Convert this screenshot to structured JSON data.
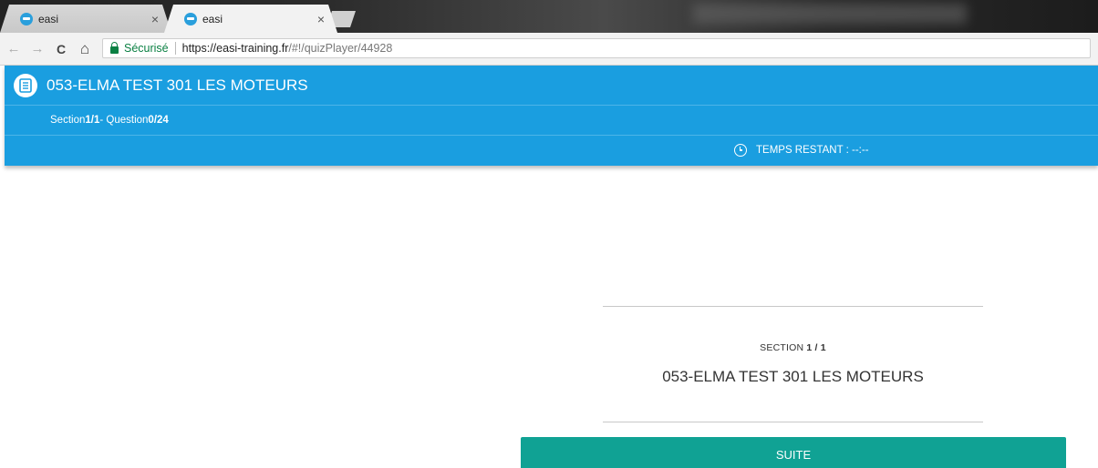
{
  "browser": {
    "tabs": [
      {
        "title": "easi",
        "active": false
      },
      {
        "title": "easi",
        "active": true
      }
    ],
    "close_glyph": "×",
    "nav": {
      "back": "←",
      "forward": "→",
      "reload": "C",
      "home": "⌂"
    },
    "secure_label": "Sécurisé",
    "url_host": "https://easi-training.fr",
    "url_path": "/#!/quizPlayer/44928"
  },
  "header": {
    "title": "053-ELMA TEST 301 LES MOTEURS",
    "progress": {
      "section_prefix": "Section ",
      "section_value": "1/1",
      "question_prefix": " - Question ",
      "question_value": "0/24"
    },
    "timer_label": "TEMPS RESTANT : --:--"
  },
  "main": {
    "section_prefix": "SECTION ",
    "section_value": "1 / 1",
    "section_title": "053-ELMA TEST 301 LES MOTEURS",
    "next_button": "SUITE"
  },
  "colors": {
    "header_blue": "#1a9ee0",
    "button_teal": "#10a294",
    "secure_green": "#0b8043"
  },
  "icons": [
    "document-icon",
    "clock-icon",
    "lock-icon",
    "favicon-icon"
  ]
}
